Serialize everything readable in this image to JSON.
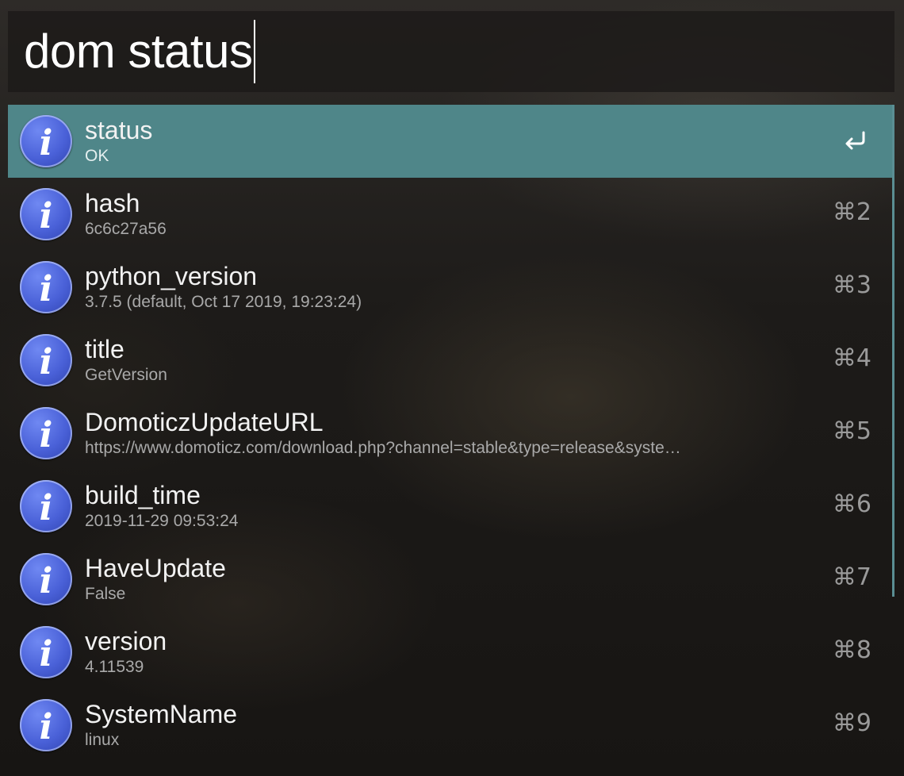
{
  "search": {
    "query": "dom status"
  },
  "results": [
    {
      "title": "status",
      "subtitle": "OK",
      "shortcut": "",
      "selected": true,
      "action_icon": "return-icon"
    },
    {
      "title": "hash",
      "subtitle": "6c6c27a56",
      "shortcut": "⌘2"
    },
    {
      "title": "python_version",
      "subtitle": "3.7.5 (default, Oct 17 2019, 19:23:24)",
      "shortcut": "⌘3"
    },
    {
      "title": "title",
      "subtitle": "GetVersion",
      "shortcut": "⌘4"
    },
    {
      "title": "DomoticzUpdateURL",
      "subtitle": "https://www.domoticz.com/download.php?channel=stable&type=release&syste…",
      "shortcut": "⌘5"
    },
    {
      "title": "build_time",
      "subtitle": "2019-11-29 09:53:24",
      "shortcut": "⌘6"
    },
    {
      "title": "HaveUpdate",
      "subtitle": "False",
      "shortcut": "⌘7"
    },
    {
      "title": "version",
      "subtitle": "4.11539",
      "shortcut": "⌘8"
    },
    {
      "title": "SystemName",
      "subtitle": "linux",
      "shortcut": "⌘9"
    }
  ],
  "colors": {
    "selected_row": "#4f8689",
    "icon_blue": "#4a61d8",
    "title_text": "#f2f2f2",
    "subtitle_text": "#a9a9a9"
  },
  "icons": {
    "result_icon": "info-icon",
    "selected_action": "return-icon"
  }
}
